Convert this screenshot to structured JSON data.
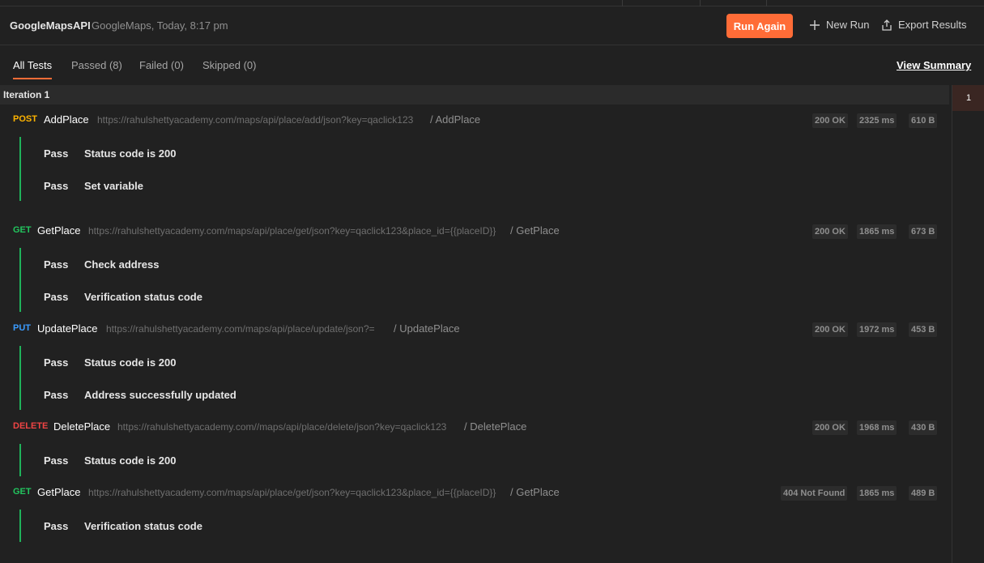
{
  "header": {
    "collection": "GoogleMapsAPI",
    "meta": "GoogleMaps, Today, 8:17 pm",
    "run_again": "Run Again",
    "new_run": "New Run",
    "export": "Export Results"
  },
  "tabs": {
    "all": "All Tests",
    "passed": "Passed (8)",
    "failed": "Failed (0)",
    "skipped": "Skipped (0)",
    "view_summary": "View Summary"
  },
  "iteration": {
    "label": "Iteration 1",
    "badge": "1"
  },
  "requests": [
    {
      "method": "POST",
      "name": "AddPlace",
      "url": "https://rahulshettyacademy.com/maps/api/place/add/json?key=qaclick123",
      "path": "/ AddPlace",
      "status": "200 OK",
      "time": "2325 ms",
      "size": "610 B",
      "tests": [
        {
          "result": "Pass",
          "name": "Status code is 200"
        },
        {
          "result": "Pass",
          "name": "Set variable"
        }
      ]
    },
    {
      "method": "GET",
      "name": "GetPlace",
      "url": "https://rahulshettyacademy.com/maps/api/place/get/json?key=qaclick123&place_id={{placeID}}",
      "path": "/ GetPlace",
      "status": "200 OK",
      "time": "1865 ms",
      "size": "673 B",
      "tests": [
        {
          "result": "Pass",
          "name": "Check address"
        },
        {
          "result": "Pass",
          "name": "Verification status code"
        }
      ]
    },
    {
      "method": "PUT",
      "name": "UpdatePlace",
      "url": "https://rahulshettyacademy.com/maps/api/place/update/json?=",
      "path": "/ UpdatePlace",
      "status": "200 OK",
      "time": "1972 ms",
      "size": "453 B",
      "tests": [
        {
          "result": "Pass",
          "name": "Status code is 200"
        },
        {
          "result": "Pass",
          "name": "Address successfully updated"
        }
      ]
    },
    {
      "method": "DELETE",
      "name": "DeletePlace",
      "url": "https://rahulshettyacademy.com//maps/api/place/delete/json?key=qaclick123",
      "path": "/ DeletePlace",
      "status": "200 OK",
      "time": "1968 ms",
      "size": "430 B",
      "tests": [
        {
          "result": "Pass",
          "name": "Status code is 200"
        }
      ]
    },
    {
      "method": "GET",
      "name": "GetPlace",
      "url": "https://rahulshettyacademy.com/maps/api/place/get/json?key=qaclick123&place_id={{placeID}}",
      "path": "/ GetPlace",
      "status": "404 Not Found",
      "time": "1865 ms",
      "size": "489 B",
      "tests": [
        {
          "result": "Pass",
          "name": "Verification status code"
        }
      ]
    }
  ]
}
